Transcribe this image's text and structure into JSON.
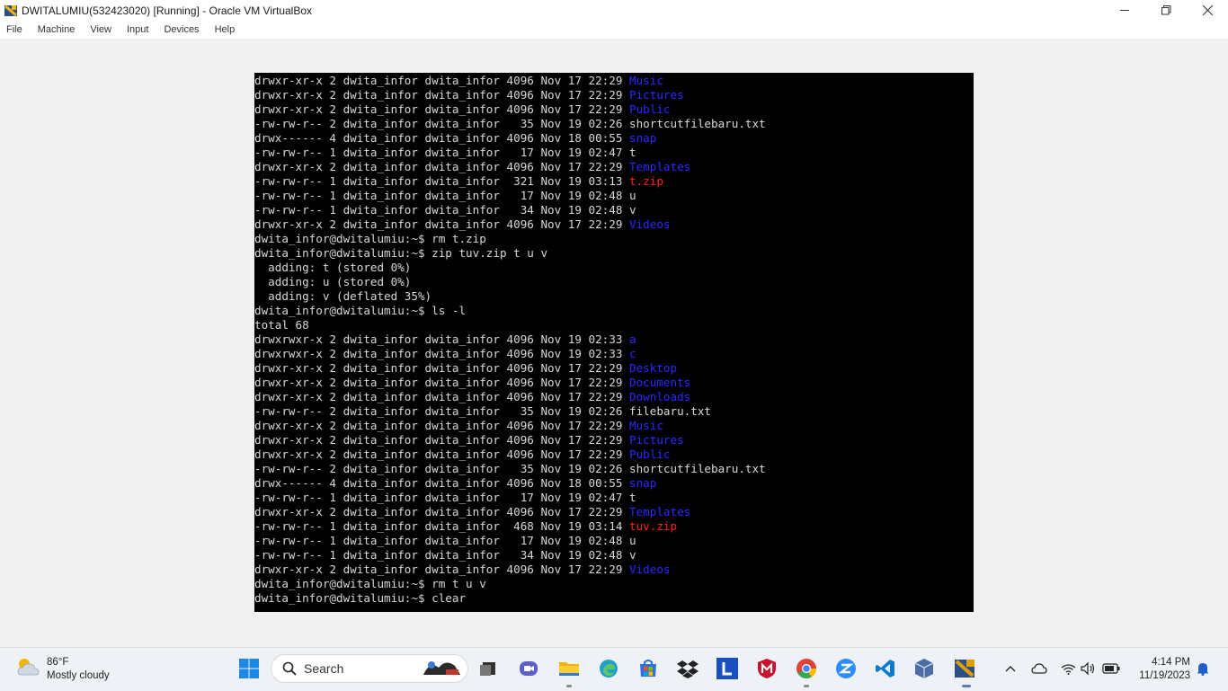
{
  "window": {
    "title": "DWITALUMIU(532423020) [Running] - Oracle VM VirtualBox",
    "controls": [
      "minimize-icon",
      "restore-icon",
      "close-icon"
    ]
  },
  "menu": [
    "File",
    "Machine",
    "View",
    "Input",
    "Devices",
    "Help"
  ],
  "terminal": {
    "lines": [
      [
        {
          "t": "drwxr-xr-x 2 dwita_infor dwita_infor 4096 Nov 17 22:29 "
        },
        {
          "t": "Music",
          "c": "blue"
        }
      ],
      [
        {
          "t": "drwxr-xr-x 2 dwita_infor dwita_infor 4096 Nov 17 22:29 "
        },
        {
          "t": "Pictures",
          "c": "blue"
        }
      ],
      [
        {
          "t": "drwxr-xr-x 2 dwita_infor dwita_infor 4096 Nov 17 22:29 "
        },
        {
          "t": "Public",
          "c": "blue"
        }
      ],
      [
        {
          "t": "-rw-rw-r-- 2 dwita_infor dwita_infor   35 Nov 19 02:26 shortcutfilebaru.txt"
        }
      ],
      [
        {
          "t": "drwx------ 4 dwita_infor dwita_infor 4096 Nov 18 00:55 "
        },
        {
          "t": "snap",
          "c": "blue"
        }
      ],
      [
        {
          "t": "-rw-rw-r-- 1 dwita_infor dwita_infor   17 Nov 19 02:47 t"
        }
      ],
      [
        {
          "t": "drwxr-xr-x 2 dwita_infor dwita_infor 4096 Nov 17 22:29 "
        },
        {
          "t": "Templates",
          "c": "blue"
        }
      ],
      [
        {
          "t": "-rw-rw-r-- 1 dwita_infor dwita_infor  321 Nov 19 03:13 "
        },
        {
          "t": "t.zip",
          "c": "red"
        }
      ],
      [
        {
          "t": "-rw-rw-r-- 1 dwita_infor dwita_infor   17 Nov 19 02:48 u"
        }
      ],
      [
        {
          "t": "-rw-rw-r-- 1 dwita_infor dwita_infor   34 Nov 19 02:48 v"
        }
      ],
      [
        {
          "t": "drwxr-xr-x 2 dwita_infor dwita_infor 4096 Nov 17 22:29 "
        },
        {
          "t": "Videos",
          "c": "blue"
        }
      ],
      [
        {
          "t": "dwita_infor@dwitalumiu:~$ rm t.zip"
        }
      ],
      [
        {
          "t": "dwita_infor@dwitalumiu:~$ zip tuv.zip t u v"
        }
      ],
      [
        {
          "t": "  adding: t (stored 0%)"
        }
      ],
      [
        {
          "t": "  adding: u (stored 0%)"
        }
      ],
      [
        {
          "t": "  adding: v (deflated 35%)"
        }
      ],
      [
        {
          "t": "dwita_infor@dwitalumiu:~$ ls -l"
        }
      ],
      [
        {
          "t": "total 68"
        }
      ],
      [
        {
          "t": "drwxrwxr-x 2 dwita_infor dwita_infor 4096 Nov 19 02:33 "
        },
        {
          "t": "a",
          "c": "blue"
        }
      ],
      [
        {
          "t": "drwxrwxr-x 2 dwita_infor dwita_infor 4096 Nov 19 02:33 "
        },
        {
          "t": "c",
          "c": "blue"
        }
      ],
      [
        {
          "t": "drwxr-xr-x 2 dwita_infor dwita_infor 4096 Nov 17 22:29 "
        },
        {
          "t": "Desktop",
          "c": "blue"
        }
      ],
      [
        {
          "t": "drwxr-xr-x 2 dwita_infor dwita_infor 4096 Nov 17 22:29 "
        },
        {
          "t": "Documents",
          "c": "blue"
        }
      ],
      [
        {
          "t": "drwxr-xr-x 2 dwita_infor dwita_infor 4096 Nov 17 22:29 "
        },
        {
          "t": "Downloads",
          "c": "blue"
        }
      ],
      [
        {
          "t": "-rw-rw-r-- 2 dwita_infor dwita_infor   35 Nov 19 02:26 filebaru.txt"
        }
      ],
      [
        {
          "t": "drwxr-xr-x 2 dwita_infor dwita_infor 4096 Nov 17 22:29 "
        },
        {
          "t": "Music",
          "c": "blue"
        }
      ],
      [
        {
          "t": "drwxr-xr-x 2 dwita_infor dwita_infor 4096 Nov 17 22:29 "
        },
        {
          "t": "Pictures",
          "c": "blue"
        }
      ],
      [
        {
          "t": "drwxr-xr-x 2 dwita_infor dwita_infor 4096 Nov 17 22:29 "
        },
        {
          "t": "Public",
          "c": "blue"
        }
      ],
      [
        {
          "t": "-rw-rw-r-- 2 dwita_infor dwita_infor   35 Nov 19 02:26 shortcutfilebaru.txt"
        }
      ],
      [
        {
          "t": "drwx------ 4 dwita_infor dwita_infor 4096 Nov 18 00:55 "
        },
        {
          "t": "snap",
          "c": "blue"
        }
      ],
      [
        {
          "t": "-rw-rw-r-- 1 dwita_infor dwita_infor   17 Nov 19 02:47 t"
        }
      ],
      [
        {
          "t": "drwxr-xr-x 2 dwita_infor dwita_infor 4096 Nov 17 22:29 "
        },
        {
          "t": "Templates",
          "c": "blue"
        }
      ],
      [
        {
          "t": "-rw-rw-r-- 1 dwita_infor dwita_infor  468 Nov 19 03:14 "
        },
        {
          "t": "tuv.zip",
          "c": "red"
        }
      ],
      [
        {
          "t": "-rw-rw-r-- 1 dwita_infor dwita_infor   17 Nov 19 02:48 u"
        }
      ],
      [
        {
          "t": "-rw-rw-r-- 1 dwita_infor dwita_infor   34 Nov 19 02:48 v"
        }
      ],
      [
        {
          "t": "drwxr-xr-x 2 dwita_infor dwita_infor 4096 Nov 17 22:29 "
        },
        {
          "t": "Videos",
          "c": "blue"
        }
      ],
      [
        {
          "t": "dwita_infor@dwitalumiu:~$ rm t u v"
        }
      ],
      [
        {
          "t": "dwita_infor@dwitalumiu:~$ clear"
        }
      ]
    ]
  },
  "taskbar": {
    "weather": {
      "temp": "86°F",
      "condition": "Mostly cloudy"
    },
    "search_placeholder": "Search",
    "pinned": [
      {
        "name": "windows-start-icon",
        "color": "#1e88e5"
      },
      {
        "name": "task-view-icon",
        "color": "#333333"
      },
      {
        "name": "meet-chat-icon",
        "color": "#5b5fc7"
      },
      {
        "name": "file-explorer-icon",
        "color": "#f4b400"
      },
      {
        "name": "edge-browser-icon",
        "color": "#1fa1c9"
      },
      {
        "name": "store-icon",
        "color": "#2f6fe0"
      },
      {
        "name": "dropbox-icon",
        "color": "#222222"
      },
      {
        "name": "l-app-icon",
        "color": "#1a4fbf"
      },
      {
        "name": "mcafee-icon",
        "color": "#c8102e"
      },
      {
        "name": "chrome-icon",
        "color": "#34a853"
      },
      {
        "name": "zoom-icon",
        "color": "#2d8cff"
      },
      {
        "name": "vscode-icon",
        "color": "#0a7acc"
      },
      {
        "name": "virtualbox-icon",
        "color": "#4a6fa5"
      },
      {
        "name": "virtualbox-vm-icon",
        "color": "#e0a000"
      }
    ],
    "clock": {
      "time": "4:14 PM",
      "date": "11/19/2023"
    }
  }
}
